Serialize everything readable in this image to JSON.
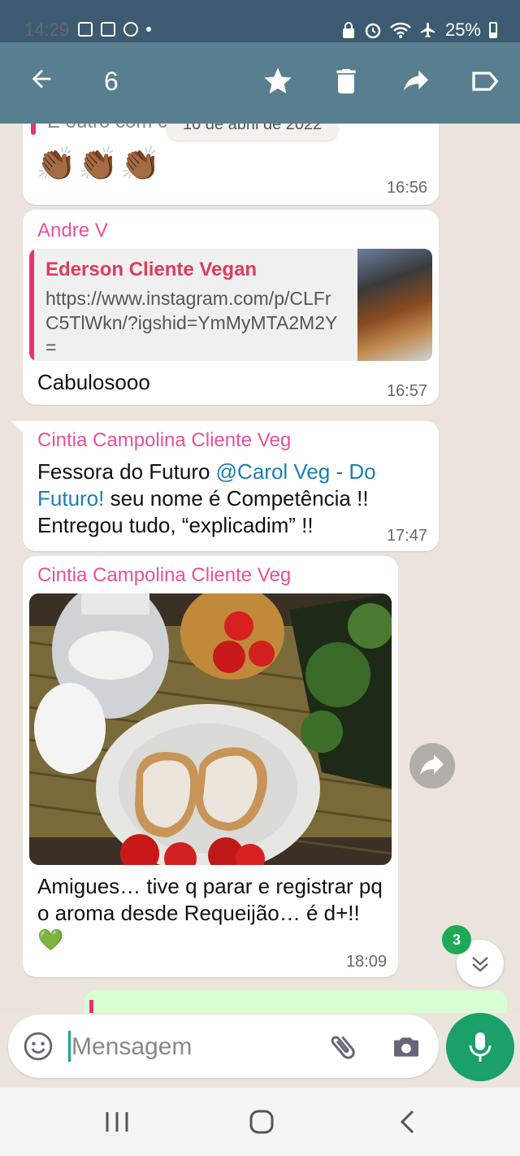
{
  "statusbar": {
    "time": "14:29",
    "battery": "25%"
  },
  "actionbar": {
    "selected_count": "6"
  },
  "chat": {
    "date_chip": "10 de abril de 2022",
    "msg1": {
      "partial_text": "E outro com c",
      "emojis": "👏🏾👏🏾👏🏾",
      "time": "16:56"
    },
    "msg2": {
      "sender": "Andre V",
      "quote_title": "Ederson Cliente Vegan",
      "quote_url": "https://www.instagram.com/p/CLFrC5TlWkn/?igshid=YmMyMTA2M2Y=",
      "text": "Cabulosooo",
      "time": "16:57"
    },
    "msg3": {
      "sender": "Cintia Campolina Cliente Veg",
      "text_before": "Fessora do Futuro ",
      "mention": "@Carol Veg - Do Futuro!",
      "text_after": " seu nome é Competência !! Entregou tudo, “explicadim” !!",
      "time": "17:47"
    },
    "msg4": {
      "sender": "Cintia Campolina Cliente Veg",
      "text": "Amigues… tive q parar e registrar pq o aroma desde Requeijão… é d+!! 💚",
      "time": "18:09"
    },
    "unread_badge": "3"
  },
  "input": {
    "placeholder": "Mensagem"
  },
  "colors": {
    "header": "#587f8f",
    "accent": "#1aa068",
    "sender": "#e8509a",
    "mention": "#1d7eb0"
  }
}
